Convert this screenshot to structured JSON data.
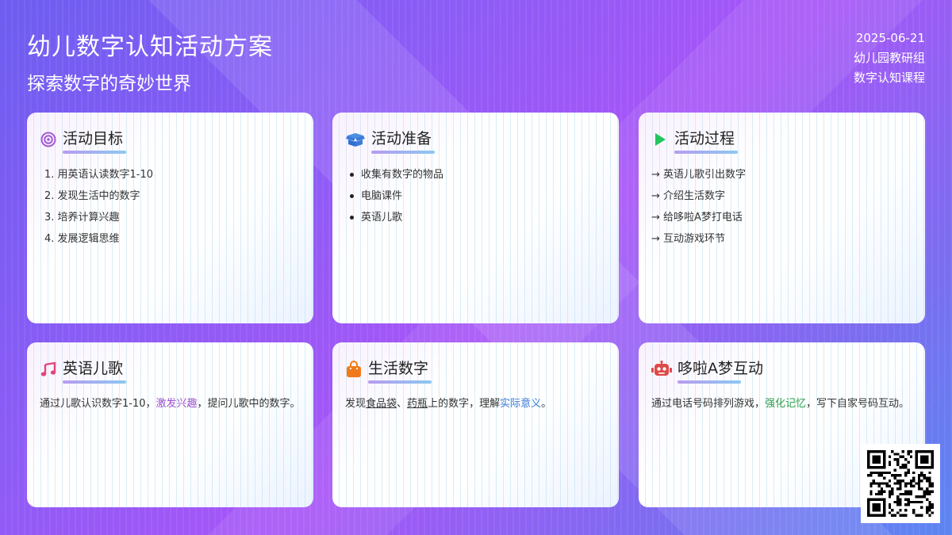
{
  "header": {
    "title": "幼儿数字认知活动方案",
    "subtitle": "探索数字的奇妙世界",
    "date": "2025-06-21",
    "org": "幼儿园教研组",
    "course": "数字认知课程"
  },
  "cards": {
    "goals": {
      "title": "活动目标",
      "icon": "target-icon",
      "items": [
        "1. 用英语认读数字1-10",
        "2. 发现生活中的数字",
        "3. 培养计算兴趣",
        "4. 发展逻辑思维"
      ]
    },
    "prep": {
      "title": "活动准备",
      "icon": "box-icon",
      "items": [
        "收集有数字的物品",
        "电脑课件",
        "英语儿歌"
      ]
    },
    "process": {
      "title": "活动过程",
      "icon": "play-icon",
      "items": [
        "→ 英语儿歌引出数字",
        "→ 介绍生活数字",
        "→ 给哆啦A梦打电话",
        "→ 互动游戏环节"
      ]
    },
    "song": {
      "title": "英语儿歌",
      "icon": "music-note-icon",
      "text_a": "通过儿歌认识数字1-10，",
      "highlight": "激发兴趣",
      "text_b": "，提问儿歌中的数字。"
    },
    "life": {
      "title": "生活数字",
      "icon": "shopping-bag-icon",
      "text_a": "发现",
      "item1": "食品袋",
      "sep": "、",
      "item2": "药瓶",
      "text_b": "上的数字，理解",
      "highlight": "实际意义",
      "text_c": "。"
    },
    "doraemon": {
      "title": "哆啦A梦互动",
      "icon": "robot-icon",
      "text_a": "通过电话号码排列游戏，",
      "highlight": "强化记忆",
      "text_b": "，写下自家号码互动。"
    }
  },
  "colors": {
    "accent_purple": "#9b4fd0",
    "accent_blue": "#3b7ad9",
    "accent_green": "#2a9d4a",
    "play_green": "#22c55e",
    "music_pink": "#e0457b",
    "bag_orange": "#f07a1a",
    "robot_red": "#e04848"
  },
  "qr": {
    "icon": "qr-code-icon"
  }
}
